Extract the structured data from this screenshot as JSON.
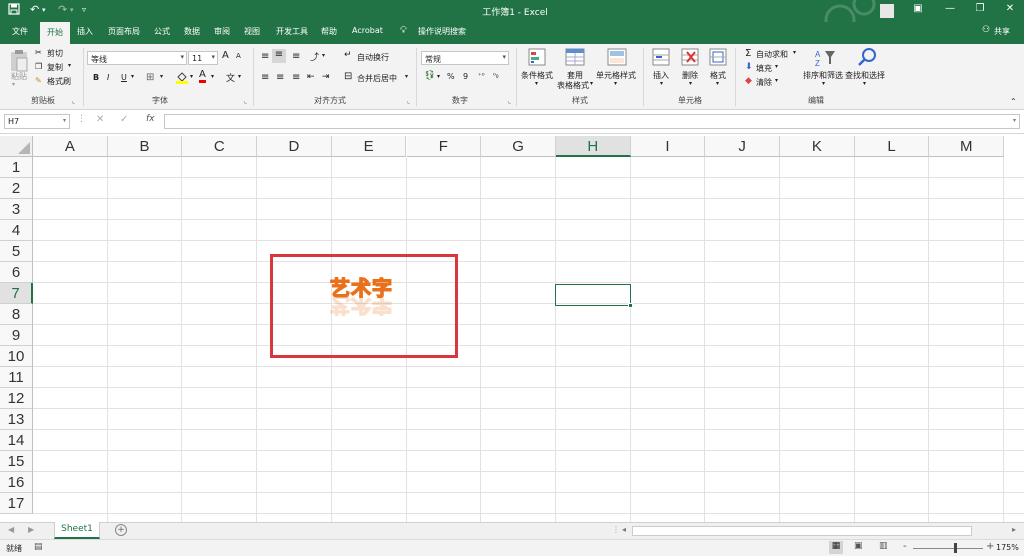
{
  "titlebar": {
    "title": "工作簿1  -  Excel",
    "save_icon": "save-icon",
    "undo_icon": "undo-icon",
    "redo_icon": "redo-icon",
    "customize_icon": "customize-quick-access-icon"
  },
  "tabs": [
    "文件",
    "开始",
    "插入",
    "页面布局",
    "公式",
    "数据",
    "审阅",
    "视图",
    "开发工具",
    "帮助",
    "Acrobat"
  ],
  "active_tab": "开始",
  "tell_me": "操作说明搜索",
  "share": "共享",
  "ribbon": {
    "clipboard": {
      "paste": "粘贴",
      "cut": "剪切",
      "copy": "复制",
      "format_painter": "格式刷",
      "label": "剪贴板"
    },
    "font": {
      "name": "等线",
      "size": "11",
      "bold": "B",
      "italic": "I",
      "underline": "U",
      "grow": "A",
      "shrink": "A",
      "wen": "文",
      "font_color_letter": "A",
      "label": "字体"
    },
    "alignment": {
      "wrap": "自动换行",
      "merge": "合并后居中",
      "label": "对齐方式"
    },
    "number": {
      "format": "常规",
      "percent": "%",
      "comma": "9",
      "label": "数字"
    },
    "styles": {
      "conditional": "条件格式",
      "table_line1": "套用",
      "table_line2": "表格格式",
      "cell": "单元格样式",
      "label": "样式"
    },
    "cells": {
      "insert": "插入",
      "delete": "删除",
      "format": "格式",
      "label": "单元格"
    },
    "editing": {
      "autosum": "自动求和",
      "fill": "填充",
      "clear": "清除",
      "sort": "排序和筛选",
      "find": "查找和选择",
      "label": "编辑"
    }
  },
  "formula_bar": {
    "name_box": "H7",
    "fx": "fx",
    "value": ""
  },
  "columns": [
    "A",
    "B",
    "C",
    "D",
    "E",
    "F",
    "G",
    "H",
    "I",
    "J",
    "K",
    "L",
    "M"
  ],
  "rows": [
    "1",
    "2",
    "3",
    "4",
    "5",
    "6",
    "7",
    "8",
    "9",
    "10",
    "11",
    "12",
    "13",
    "14",
    "15",
    "16",
    "17"
  ],
  "selected_cell": "H7",
  "wordart": {
    "text": "艺术字",
    "fill_color": "#f5b46a",
    "outline_color": "#e9711c"
  },
  "highlight_color": "#d9363e",
  "sheets": [
    "Sheet1"
  ],
  "status": {
    "ready": "就绪",
    "zoom": "175%",
    "zoom_minus": "-",
    "zoom_plus": "+"
  },
  "colors": {
    "accent": "#217346"
  }
}
